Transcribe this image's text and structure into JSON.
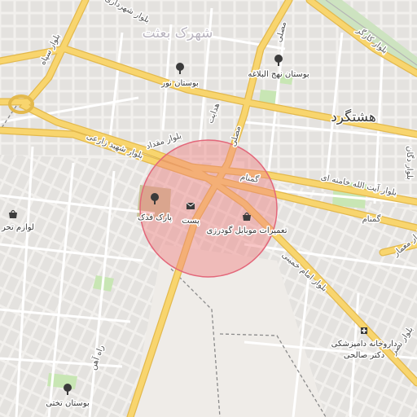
{
  "map": {
    "district_labels": {
      "hashtgerd": "هشتگرد",
      "shahrak_besat": "شهرک بعثت"
    },
    "road_labels": {
      "blvd_siah": "بلوار سپاه",
      "blvd_shahrdari": "بلوار شهرداری",
      "blvd_karaj": "بلوار کارگر",
      "blvd_miqdad": "بلوار مقداد",
      "blvd_shahid_zarei": "بلوار شهید زارعی",
      "blvd_ayatollah_khamenei": "بلوار آیت الله خامنه ای",
      "blvd_imam_khomeini": "بلوار امام خمینی",
      "blvd_mamar": "بلوار معمار",
      "blvd_nasr": "بلوار نصر",
      "mosalla": "مصلی",
      "hedayat": "هدایت",
      "gomnam_1": "گمنام",
      "gomnam_2": "گمنام",
      "gomnam_3": "گمنام",
      "rah_ahan": "راه آهن",
      "blvd_edge_right": "بلوار دگان"
    },
    "poi_labels": {
      "bustan_nour": "بوستان نور",
      "bustan_nahj": "بوستان نهج البلاغه",
      "park_fadak": "پارک فدک",
      "post": "پست",
      "tamirat": "تعمیرات موبایل گودرزی",
      "darokhaneh_line1": "داروخانه دامپزشکی",
      "darokhaneh_line2": "دکتر صالحی",
      "bustan_takhti": "بوستان تختی",
      "lavazem": "لوازم تحر"
    },
    "icons": [
      "park-icon",
      "post-icon",
      "shop-icon",
      "pharmacy-icon",
      "shopping-icon"
    ],
    "colors": {
      "background": "#f2f0ed",
      "block": "#e3e1de",
      "major_road": "#f7d36a",
      "major_road_casing": "#e5b84a",
      "minor_road": "#ffffff",
      "park": "#c8e6b4",
      "circle_fill": "#f08080",
      "circle_stroke": "#e3677a"
    }
  }
}
